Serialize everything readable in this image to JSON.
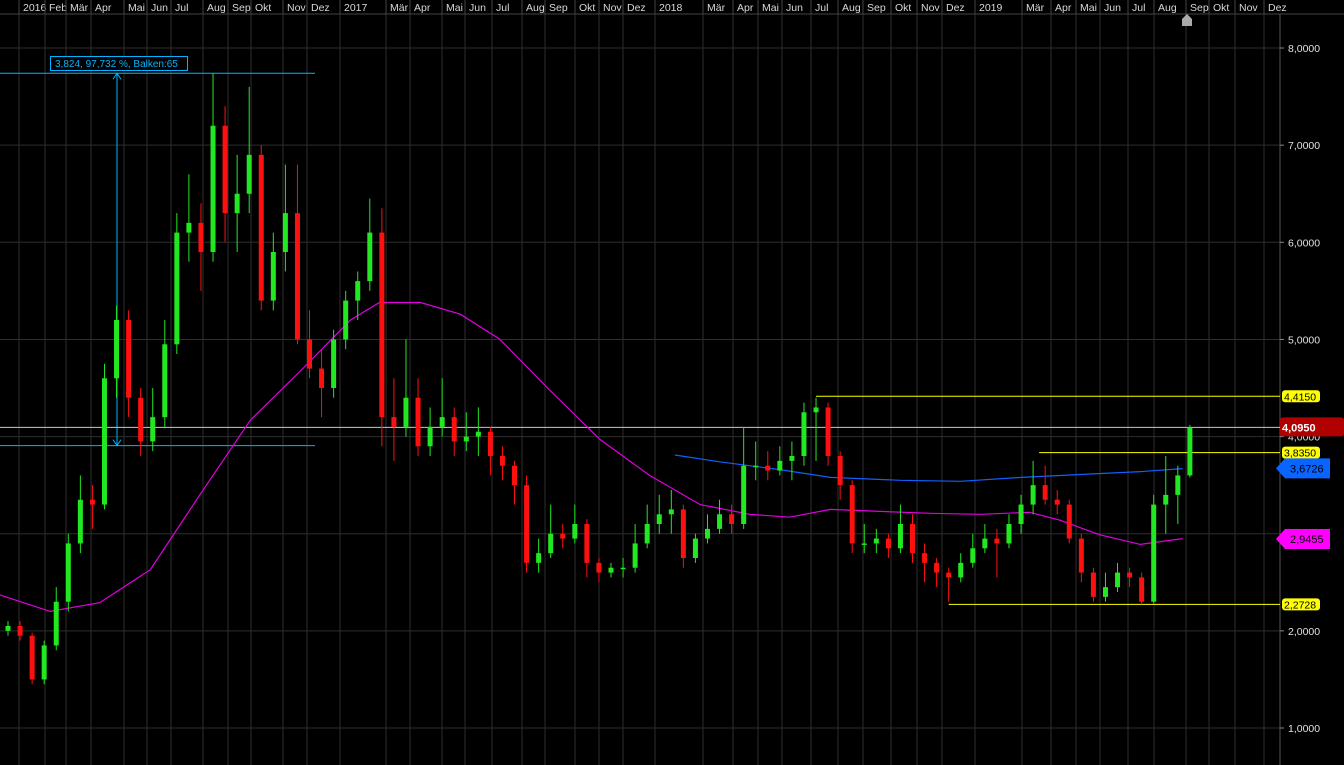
{
  "chart_data": {
    "type": "candlestick",
    "title": "",
    "time_axis_labels": [
      "2016",
      "Feb",
      "Mär",
      "Apr",
      "Mai",
      "Jun",
      "Jul",
      "Aug",
      "Sep",
      "Okt",
      "Nov",
      "Dez",
      "2017",
      "Mär",
      "Apr",
      "Mai",
      "Jun",
      "Jul",
      "Aug",
      "Sep",
      "Okt",
      "Nov",
      "Dez",
      "2018",
      "Mär",
      "Apr",
      "Mai",
      "Jun",
      "Jul",
      "Aug",
      "Sep",
      "Okt",
      "Nov",
      "Dez",
      "2019",
      "Mär",
      "Apr",
      "Mai",
      "Jun",
      "Jul",
      "Aug",
      "Sep",
      "Okt",
      "Nov",
      "Dez"
    ],
    "y_ticks": [
      "8,0000",
      "7,0000",
      "6,0000",
      "5,0000",
      "4,0000",
      "2,0000",
      "1,0000"
    ],
    "y_tick_values": [
      8,
      7,
      6,
      5,
      4,
      2,
      1
    ],
    "ylim": [
      0.63,
      8.5
    ],
    "grid": true,
    "candles_ohlc": [
      [
        2.0,
        2.1,
        1.95,
        2.05
      ],
      [
        2.05,
        2.1,
        1.9,
        1.95
      ],
      [
        1.95,
        1.98,
        1.45,
        1.5
      ],
      [
        1.5,
        1.9,
        1.45,
        1.85
      ],
      [
        1.85,
        2.45,
        1.8,
        2.3
      ],
      [
        2.3,
        3.0,
        2.2,
        2.9
      ],
      [
        2.9,
        3.6,
        2.8,
        3.35
      ],
      [
        3.35,
        3.5,
        3.05,
        3.3
      ],
      [
        3.3,
        4.75,
        3.25,
        4.6
      ],
      [
        4.6,
        5.35,
        4.4,
        5.2
      ],
      [
        5.2,
        5.3,
        4.2,
        4.4
      ],
      [
        4.4,
        4.5,
        3.8,
        3.95
      ],
      [
        3.95,
        4.5,
        3.85,
        4.2
      ],
      [
        4.2,
        5.2,
        4.1,
        4.95
      ],
      [
        4.95,
        6.3,
        4.85,
        6.1
      ],
      [
        6.1,
        6.7,
        5.8,
        6.2
      ],
      [
        6.2,
        6.4,
        5.5,
        5.9
      ],
      [
        5.9,
        7.74,
        5.8,
        7.2
      ],
      [
        7.2,
        7.4,
        6.0,
        6.3
      ],
      [
        6.3,
        6.9,
        5.9,
        6.5
      ],
      [
        6.5,
        7.6,
        6.3,
        6.9
      ],
      [
        6.9,
        7.0,
        5.3,
        5.4
      ],
      [
        5.4,
        6.1,
        5.3,
        5.9
      ],
      [
        5.9,
        6.8,
        5.7,
        6.3
      ],
      [
        6.3,
        6.8,
        4.95,
        5.0
      ],
      [
        5.0,
        5.3,
        4.6,
        4.7
      ],
      [
        4.7,
        4.9,
        4.2,
        4.5
      ],
      [
        4.5,
        5.1,
        4.4,
        5.0
      ],
      [
        5.0,
        5.5,
        4.9,
        5.4
      ],
      [
        5.4,
        5.7,
        5.2,
        5.6
      ],
      [
        5.6,
        6.45,
        5.5,
        6.1
      ],
      [
        6.1,
        6.35,
        3.9,
        4.2
      ],
      [
        4.2,
        4.6,
        3.75,
        4.1
      ],
      [
        4.1,
        5.0,
        4.0,
        4.4
      ],
      [
        4.4,
        4.6,
        3.8,
        3.9
      ],
      [
        3.9,
        4.3,
        3.8,
        4.1
      ],
      [
        4.1,
        4.6,
        4.0,
        4.2
      ],
      [
        4.2,
        4.3,
        3.8,
        3.95
      ],
      [
        3.95,
        4.25,
        3.85,
        4.0
      ],
      [
        4.0,
        4.3,
        3.8,
        4.05
      ],
      [
        4.05,
        4.1,
        3.6,
        3.8
      ],
      [
        3.8,
        3.9,
        3.55,
        3.7
      ],
      [
        3.7,
        3.75,
        3.3,
        3.5
      ],
      [
        3.5,
        3.6,
        2.6,
        2.7
      ],
      [
        2.7,
        2.95,
        2.6,
        2.8
      ],
      [
        2.8,
        3.3,
        2.75,
        3.0
      ],
      [
        3.0,
        3.1,
        2.85,
        2.95
      ],
      [
        2.95,
        3.3,
        2.9,
        3.1
      ],
      [
        3.1,
        3.15,
        2.55,
        2.7
      ],
      [
        2.7,
        2.75,
        2.5,
        2.6
      ],
      [
        2.6,
        2.7,
        2.55,
        2.65
      ],
      [
        2.65,
        2.75,
        2.55,
        2.65
      ],
      [
        2.65,
        3.1,
        2.6,
        2.9
      ],
      [
        2.9,
        3.3,
        2.85,
        3.1
      ],
      [
        3.1,
        3.4,
        3.0,
        3.2
      ],
      [
        3.2,
        3.45,
        3.0,
        3.25
      ],
      [
        3.25,
        3.3,
        2.65,
        2.75
      ],
      [
        2.75,
        3.0,
        2.7,
        2.95
      ],
      [
        2.95,
        3.2,
        2.9,
        3.05
      ],
      [
        3.05,
        3.35,
        3.0,
        3.2
      ],
      [
        3.2,
        3.3,
        3.0,
        3.1
      ],
      [
        3.1,
        4.1,
        3.05,
        3.7
      ],
      [
        3.7,
        3.95,
        3.55,
        3.7
      ],
      [
        3.7,
        3.85,
        3.55,
        3.65
      ],
      [
        3.65,
        3.9,
        3.6,
        3.75
      ],
      [
        3.75,
        3.95,
        3.55,
        3.8
      ],
      [
        3.8,
        4.35,
        3.7,
        4.25
      ],
      [
        4.25,
        4.4,
        3.75,
        4.3
      ],
      [
        4.3,
        4.35,
        3.7,
        3.8
      ],
      [
        3.8,
        3.85,
        3.35,
        3.5
      ],
      [
        3.5,
        3.55,
        2.8,
        2.9
      ],
      [
        2.9,
        3.1,
        2.8,
        2.9
      ],
      [
        2.9,
        3.05,
        2.8,
        2.95
      ],
      [
        2.95,
        3.0,
        2.75,
        2.85
      ],
      [
        2.85,
        3.3,
        2.8,
        3.1
      ],
      [
        3.1,
        3.2,
        2.7,
        2.8
      ],
      [
        2.8,
        2.9,
        2.5,
        2.7
      ],
      [
        2.7,
        2.75,
        2.45,
        2.6
      ],
      [
        2.6,
        2.65,
        2.3,
        2.55
      ],
      [
        2.55,
        2.8,
        2.5,
        2.7
      ],
      [
        2.7,
        3.0,
        2.65,
        2.85
      ],
      [
        2.85,
        3.1,
        2.8,
        2.95
      ],
      [
        2.95,
        3.05,
        2.55,
        2.9
      ],
      [
        2.9,
        3.2,
        2.85,
        3.1
      ],
      [
        3.1,
        3.4,
        3.0,
        3.3
      ],
      [
        3.3,
        3.75,
        3.2,
        3.5
      ],
      [
        3.5,
        3.7,
        3.3,
        3.35
      ],
      [
        3.35,
        3.45,
        3.2,
        3.3
      ],
      [
        3.3,
        3.35,
        2.9,
        2.95
      ],
      [
        2.95,
        3.0,
        2.5,
        2.6
      ],
      [
        2.6,
        2.65,
        2.3,
        2.35
      ],
      [
        2.35,
        2.6,
        2.3,
        2.45
      ],
      [
        2.45,
        2.7,
        2.4,
        2.6
      ],
      [
        2.6,
        2.65,
        2.45,
        2.55
      ],
      [
        2.55,
        2.6,
        2.2728,
        2.3
      ],
      [
        2.3,
        3.4,
        2.28,
        3.3
      ],
      [
        3.3,
        3.8,
        3.0,
        3.4
      ],
      [
        3.4,
        3.7,
        3.1,
        3.6
      ],
      [
        3.6,
        4.12,
        3.58,
        4.095
      ]
    ],
    "series": [
      {
        "name": "moving-average-magenta",
        "color": "#e000e0",
        "points": [
          [
            -0.7,
            2.37
          ],
          [
            3.5,
            2.2
          ],
          [
            7.6,
            2.29
          ],
          [
            11.8,
            2.63
          ],
          [
            15.9,
            3.4
          ],
          [
            20.1,
            4.17
          ],
          [
            24.2,
            4.67
          ],
          [
            28.4,
            5.2
          ],
          [
            30.8,
            5.38
          ],
          [
            34.2,
            5.38
          ],
          [
            37.5,
            5.26
          ],
          [
            40.8,
            5.0
          ],
          [
            44.9,
            4.48
          ],
          [
            49.1,
            3.97
          ],
          [
            53.2,
            3.6
          ],
          [
            57.4,
            3.3
          ],
          [
            61.5,
            3.2
          ],
          [
            64.8,
            3.17
          ],
          [
            68.2,
            3.25
          ],
          [
            72.3,
            3.23
          ],
          [
            76.5,
            3.21
          ],
          [
            80.6,
            3.2
          ],
          [
            84.7,
            3.22
          ],
          [
            87.2,
            3.14
          ],
          [
            90.5,
            2.99
          ],
          [
            93.9,
            2.89
          ],
          [
            97.4,
            2.95
          ]
        ]
      },
      {
        "name": "moving-average-blue",
        "color": "#1060ff",
        "points": [
          [
            55.3,
            3.81
          ],
          [
            59,
            3.74
          ],
          [
            64,
            3.66
          ],
          [
            68.2,
            3.58
          ],
          [
            74,
            3.55
          ],
          [
            79,
            3.54
          ],
          [
            84,
            3.58
          ],
          [
            88.9,
            3.61
          ],
          [
            93.9,
            3.64
          ],
          [
            97.4,
            3.67
          ]
        ]
      }
    ],
    "levels": [
      {
        "name": "resistance-line-4-415",
        "value": 4.415,
        "label": "4,4150",
        "color": "#ffff00",
        "from_index": 67
      },
      {
        "name": "level-line-3-835",
        "value": 3.835,
        "label": "3,8350",
        "color": "#ffff00",
        "from_index": 85.5
      },
      {
        "name": "support-line-2-2728",
        "value": 2.2728,
        "label": "2,2728",
        "color": "#ffff00",
        "from_index": 78
      }
    ],
    "last_price": {
      "value": 4.095,
      "label": "4,0950",
      "color": "#b00000"
    },
    "ma_tags": [
      {
        "value": 3.6726,
        "label": "3,6726",
        "color": "#0a64ff"
      },
      {
        "value": 2.9455,
        "label": "2,9455",
        "color": "#ff00ff"
      }
    ],
    "measure": {
      "text": "3,824, 97,732 %, Balken:65",
      "high": 7.74,
      "low": 3.907,
      "color": "#00b4ff"
    }
  }
}
